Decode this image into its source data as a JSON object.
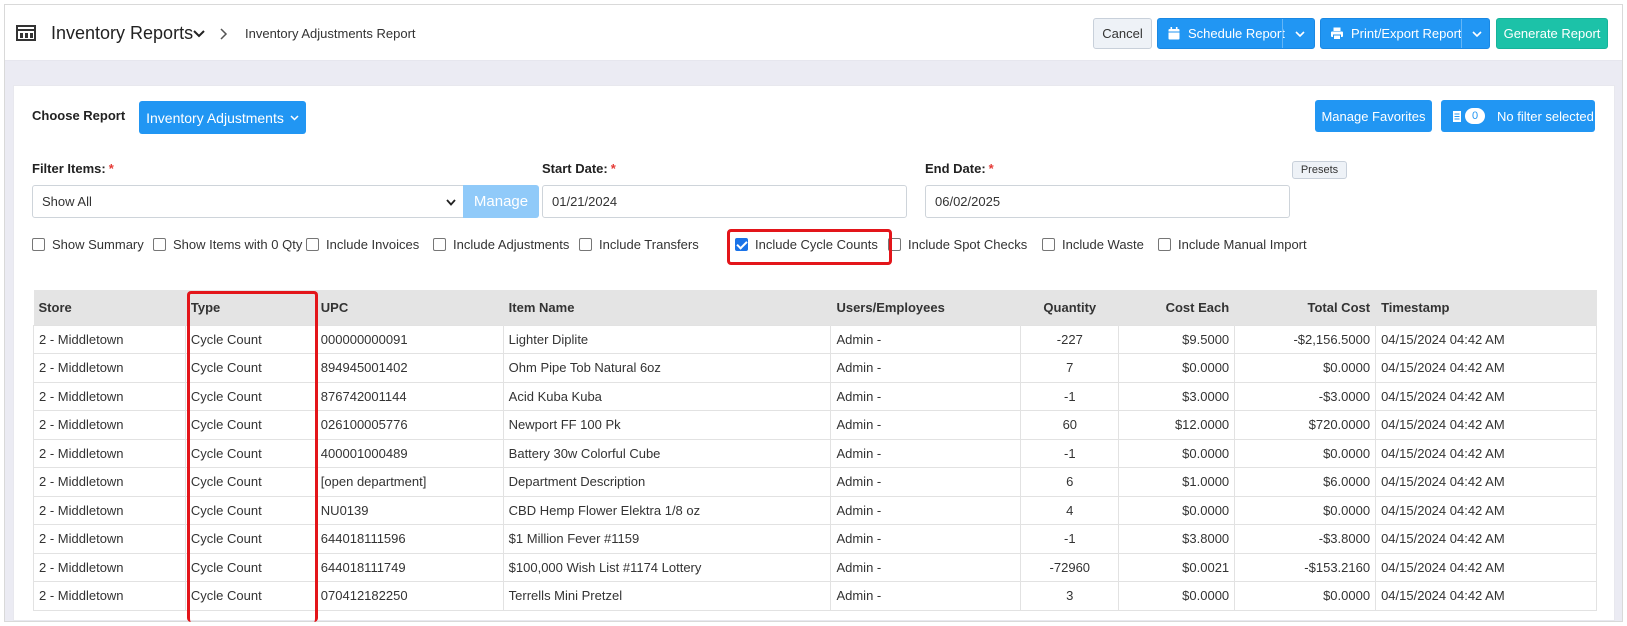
{
  "header": {
    "title": "Inventory Reports",
    "breadcrumb": "Inventory Adjustments Report",
    "cancel_label": "Cancel",
    "schedule_label": "Schedule Report",
    "print_label": "Print/Export Report",
    "generate_label": "Generate Report"
  },
  "report": {
    "choose_label": "Choose Report",
    "selected": "Inventory Adjustments",
    "manage_favorites": "Manage Favorites",
    "filter_count": "0",
    "filter_label": "No filter selected"
  },
  "filters": {
    "filter_items_label": "Filter Items:",
    "filter_items_value": "Show All",
    "manage_label": "Manage",
    "start_date_label": "Start Date:",
    "start_date_value": "01/21/2024",
    "end_date_label": "End Date:",
    "end_date_value": "06/02/2025",
    "presets_label": "Presets",
    "required_mark": "*"
  },
  "options": [
    {
      "label": "Show Summary",
      "checked": false
    },
    {
      "label": "Show Items with 0 Qty",
      "checked": false
    },
    {
      "label": "Include Invoices",
      "checked": false
    },
    {
      "label": "Include Adjustments",
      "checked": false
    },
    {
      "label": "Include Transfers",
      "checked": false
    },
    {
      "label": "Include Cycle Counts",
      "checked": true
    },
    {
      "label": "Include Spot Checks",
      "checked": false
    },
    {
      "label": "Include Waste",
      "checked": false
    },
    {
      "label": "Include Manual Import",
      "checked": false
    }
  ],
  "table": {
    "columns": [
      "Store",
      "Type",
      "UPC",
      "Item Name",
      "Users/Employees",
      "Quantity",
      "Cost Each",
      "Total Cost",
      "Timestamp"
    ],
    "rows": [
      [
        "2 - Middletown",
        "Cycle Count",
        "000000000091",
        "Lighter Diplite",
        "Admin -",
        "-227",
        "$9.5000",
        "-$2,156.5000",
        "04/15/2024 04:42 AM"
      ],
      [
        "2 - Middletown",
        "Cycle Count",
        "894945001402",
        "Ohm Pipe Tob Natural 6oz",
        "Admin -",
        "7",
        "$0.0000",
        "$0.0000",
        "04/15/2024 04:42 AM"
      ],
      [
        "2 - Middletown",
        "Cycle Count",
        "876742001144",
        "Acid Kuba Kuba",
        "Admin -",
        "-1",
        "$3.0000",
        "-$3.0000",
        "04/15/2024 04:42 AM"
      ],
      [
        "2 - Middletown",
        "Cycle Count",
        "026100005776",
        "Newport FF 100 Pk",
        "Admin -",
        "60",
        "$12.0000",
        "$720.0000",
        "04/15/2024 04:42 AM"
      ],
      [
        "2 - Middletown",
        "Cycle Count",
        "400001000489",
        "Battery 30w Colorful Cube",
        "Admin -",
        "-1",
        "$0.0000",
        "$0.0000",
        "04/15/2024 04:42 AM"
      ],
      [
        "2 - Middletown",
        "Cycle Count",
        "[open department]",
        "Department Description",
        "Admin -",
        "6",
        "$1.0000",
        "$6.0000",
        "04/15/2024 04:42 AM"
      ],
      [
        "2 - Middletown",
        "Cycle Count",
        "NU0139",
        "CBD Hemp Flower Elektra 1/8 oz",
        "Admin -",
        "4",
        "$0.0000",
        "$0.0000",
        "04/15/2024 04:42 AM"
      ],
      [
        "2 - Middletown",
        "Cycle Count",
        "644018111596",
        "$1 Million Fever #1159",
        "Admin -",
        "-1",
        "$3.8000",
        "-$3.8000",
        "04/15/2024 04:42 AM"
      ],
      [
        "2 - Middletown",
        "Cycle Count",
        "644018111749",
        "$100,000 Wish List #1174 Lottery",
        "Admin -",
        "-72960",
        "$0.0021",
        "-$153.2160",
        "04/15/2024 04:42 AM"
      ],
      [
        "2 - Middletown",
        "Cycle Count",
        "070412182250",
        "Terrells Mini Pretzel",
        "Admin -",
        "3",
        "$0.0000",
        "$0.0000",
        "04/15/2024 04:42 AM"
      ]
    ]
  },
  "colors": {
    "primary": "#2196f3",
    "generate": "#1cc2a8",
    "highlight": "#e3151a"
  }
}
